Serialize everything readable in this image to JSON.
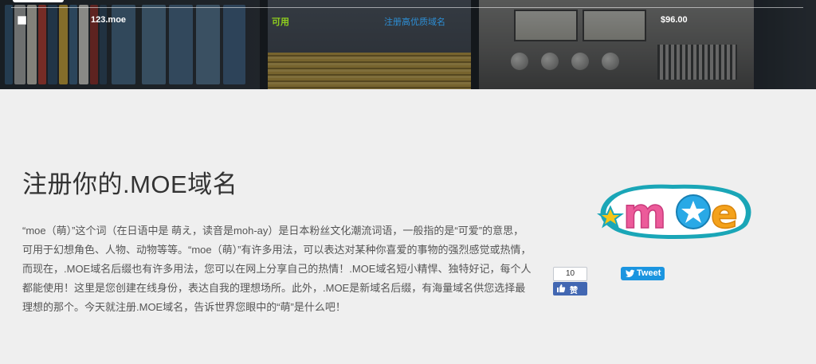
{
  "domain_row": {
    "name": "123.moe",
    "status": "可用",
    "link": "注册高优质域名",
    "price": "$96.00"
  },
  "content": {
    "title": "注册你的.MOE域名",
    "description": "“moe（萌）”这个词（在日语中是 萌え，读音是moh-ay）是日本粉丝文化潮流词语，一般指的是“可爱”的意思，可用于幻想角色、人物、动物等等。“moe（萌）”有许多用法，可以表达对某种你喜爱的事物的强烈感觉或热情，而现在，.MOE域名后缀也有许多用法，您可以在网上分享自己的热情！.MOE域名短小精悍、独特好记，每个人都能使用！这里是您创建在线身份，表达自我的理想场所。此外，.MOE是新域名后缀，有海量域名供您选择最理想的那个。今天就注册.MOE域名，告诉世界您眼中的“萌”是什么吧！"
  },
  "logo": {
    "text": "moe"
  },
  "social": {
    "facebook_count": "10",
    "facebook_label": "赞",
    "tweet_label": "Tweet"
  },
  "colors": {
    "status_available": "#8fce1e",
    "link": "#2d8fd6",
    "facebook": "#4267b2",
    "twitter": "#1b95e0"
  }
}
